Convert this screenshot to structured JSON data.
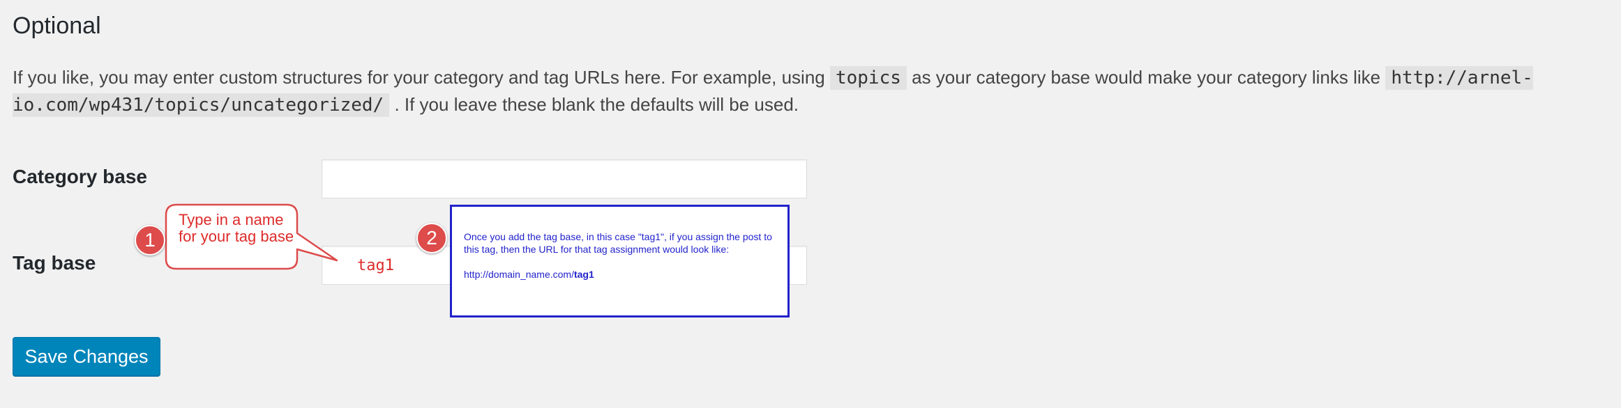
{
  "section": {
    "title": "Optional",
    "intro_before": "If you like, you may enter custom structures for your category and tag URLs here. For example, using ",
    "intro_code_1": "topics",
    "intro_middle": " as your category base would make your category links like ",
    "intro_code_2": "http://arnel-io.com/wp431/topics/uncategorized/",
    "intro_after": " . If you leave these blank the defaults will be used."
  },
  "fields": {
    "category_base_label": "Category base",
    "category_base_value": "",
    "tag_base_label": "Tag base",
    "tag_base_value": "tag1"
  },
  "actions": {
    "save_label": "Save Changes"
  },
  "annotations": {
    "badge_1": "1",
    "badge_2": "2",
    "callout_1_text": "Type in a name for your tag base",
    "info_box_text_1": "Once you add the tag base, in this case \"tag1\", if you assign the post to this tag, then the URL for that tag assignment would look like:",
    "info_box_url_prefix": "http://domain_name.com/",
    "info_box_url_tag": "tag1"
  },
  "colors": {
    "primary_button": "#0085ba",
    "annotation_red": "#dd4b4b",
    "info_box_blue": "#2222cc",
    "page_background": "#f1f1f1"
  }
}
